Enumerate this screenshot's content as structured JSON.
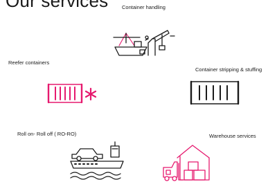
{
  "heading": "Our services",
  "colors": {
    "accent": "#e6196e",
    "dark": "#1a1a1a"
  },
  "services": [
    {
      "label": "Container handling",
      "icon": "port-crane-ship-icon"
    },
    {
      "label": "Reefer containers",
      "icon": "reefer-container-icon"
    },
    {
      "label": "Container stripping & stuffing",
      "icon": "shipping-container-icon"
    },
    {
      "label": "Roll on- Roll off ( RO-RO)",
      "icon": "roro-ship-car-icon"
    },
    {
      "label": "Warehouse services",
      "icon": "warehouse-forklift-icon"
    }
  ]
}
